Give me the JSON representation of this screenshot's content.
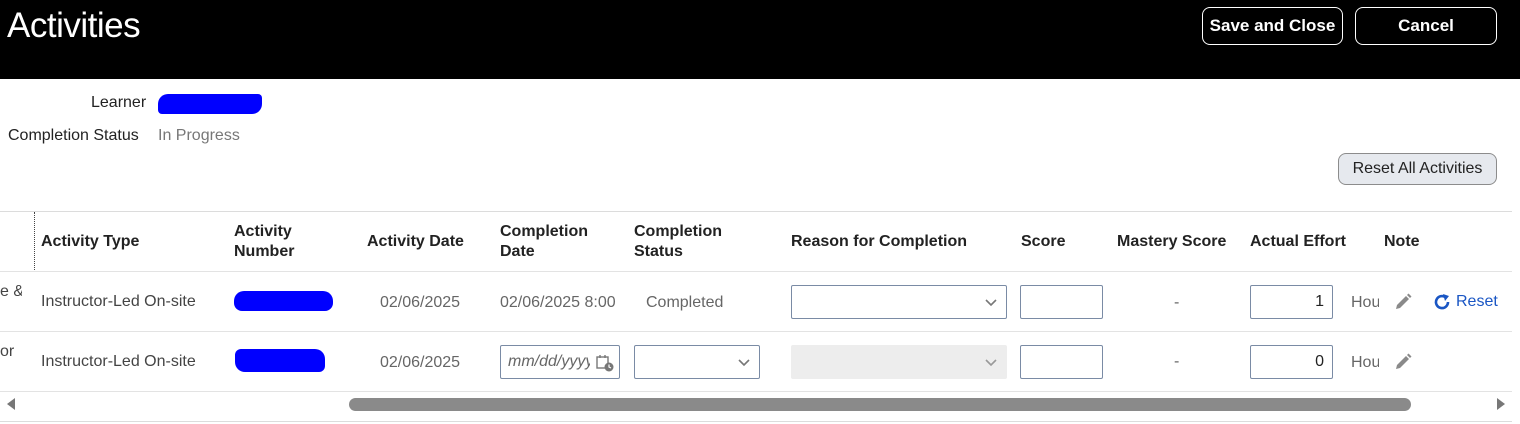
{
  "header": {
    "title": "Activities",
    "save_label": "Save and Close",
    "cancel_label": "Cancel"
  },
  "info": {
    "learner_label": "Learner",
    "completion_status_label": "Completion Status",
    "completion_status_value": "In Progress"
  },
  "reset_all_label": "Reset All Activities",
  "table": {
    "columns": [
      "Activity Type",
      "Activity Number",
      "Activity Date",
      "Completion Date",
      "Completion Status",
      "Reason for Completion",
      "Score",
      "Mastery Score",
      "Actual Effort",
      "Note"
    ],
    "column_lines": {
      "activity_number": [
        "Activity",
        "Number"
      ],
      "completion_date": [
        "Completion",
        "Date"
      ],
      "completion_status": [
        "Completion",
        "Status"
      ]
    },
    "rows": [
      {
        "first_col_fragment": "e &",
        "activity_type": "Instructor-Led On-site",
        "activity_date": "02/06/2025",
        "completion_date": "02/06/2025 8:00",
        "completion_status": "Completed",
        "reason": "",
        "score": "",
        "mastery_score": "-",
        "actual_effort": "1",
        "effort_unit": "Hou",
        "reset_label": "Reset"
      },
      {
        "first_col_fragment": "or",
        "activity_type": "Instructor-Led On-site",
        "activity_date": "02/06/2025",
        "completion_date_placeholder": "mm/dd/yyyy",
        "completion_status": "",
        "reason": "",
        "score": "",
        "mastery_score": "-",
        "actual_effort": "0",
        "effort_unit": "Hou"
      }
    ]
  },
  "icons": {
    "pencil": "pencil-icon",
    "reset": "refresh-icon",
    "calendar": "calendar-icon",
    "chevron": "chevron-down-icon"
  },
  "colors": {
    "header_bg": "#000000",
    "link": "#1a56c4",
    "redaction": "#0000ff"
  }
}
